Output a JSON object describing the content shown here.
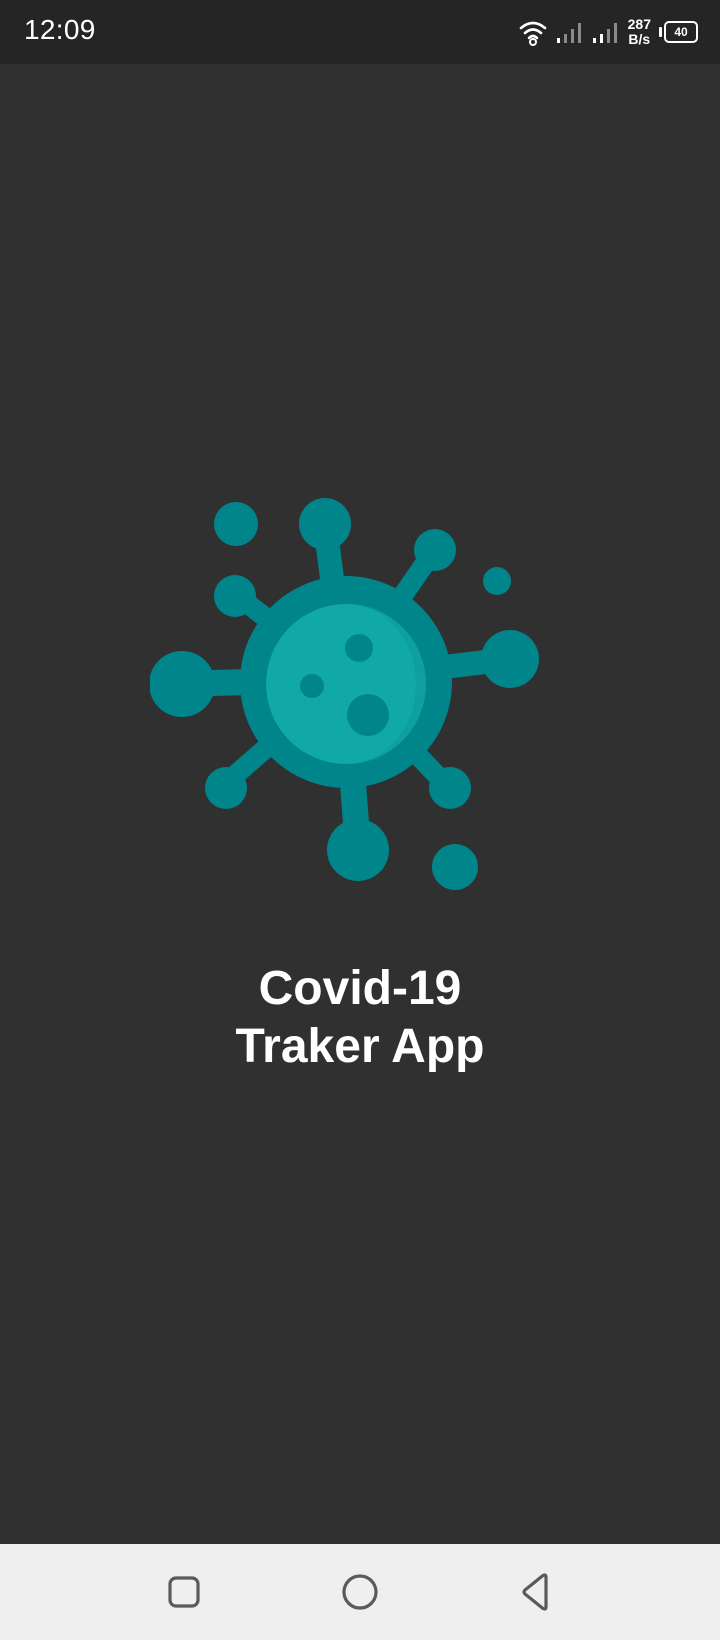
{
  "status_bar": {
    "time": "12:09",
    "net_speed_value": "287",
    "net_speed_unit": "B/s",
    "battery_level": "40",
    "icons": [
      "wifi-icon",
      "signal-icon",
      "signal-icon",
      "battery-icon"
    ]
  },
  "splash": {
    "logo_icon": "virus-icon",
    "title_line1": "Covid-19",
    "title_line2": "Traker App"
  },
  "nav_bar": {
    "icons": [
      "recents-icon",
      "home-icon",
      "back-icon"
    ]
  },
  "colors": {
    "background": "#303030",
    "status_bar": "#252525",
    "accent_dark": "#00858a",
    "accent_light": "#11a8a8",
    "nav_bar": "#efefef"
  }
}
